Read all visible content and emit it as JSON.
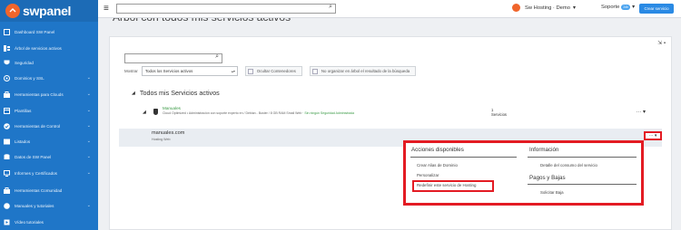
{
  "brand": {
    "name": "swpanel"
  },
  "sidebar": {
    "items": [
      {
        "label": "Dashboard SW Panel",
        "icon": "dashboard-icon",
        "chevron": false
      },
      {
        "label": "Árbol de servicios activos",
        "icon": "tree-icon",
        "chevron": false
      },
      {
        "label": "Seguridad",
        "icon": "shield-icon",
        "chevron": false
      },
      {
        "label": "Dominios y SSL",
        "icon": "domain-icon",
        "chevron": true
      },
      {
        "label": "Herramientas para Clouds",
        "icon": "toolbox-icon",
        "chevron": true
      },
      {
        "label": "Plantillas",
        "icon": "template-icon",
        "chevron": true
      },
      {
        "label": "Herramientas de Control",
        "icon": "check-circle-icon",
        "chevron": true
      },
      {
        "label": "Listados",
        "icon": "list-icon",
        "chevron": true
      },
      {
        "label": "Datos de SW Panel",
        "icon": "database-icon",
        "chevron": true
      },
      {
        "label": "Informes y Certificados",
        "icon": "report-icon",
        "chevron": true
      },
      {
        "label": "Herramientas Comunidad",
        "icon": "community-icon",
        "chevron": false
      },
      {
        "label": "Manuales y tutoriales",
        "icon": "book-icon",
        "chevron": true
      },
      {
        "label": "Vídeo tutoriales",
        "icon": "video-icon",
        "chevron": false
      }
    ]
  },
  "topbar": {
    "search_value": "",
    "user_label": "Sw Hosting · Demo",
    "user_caret": "▾",
    "support_label": "Soporte",
    "support_badge": "24h",
    "create_button": "Crear servicio"
  },
  "page": {
    "title": "Árbol con todos mis servicios activos"
  },
  "filters": {
    "search_value": "",
    "show_label": "Mostrar",
    "select_value": "Todos los Servicios activos",
    "hide_containers": "Ocultar Contenedores",
    "no_tree": "No organizar en árbol el resultado de la búsqueda"
  },
  "tree": {
    "title": "Todos mis Servicios activos",
    "service": {
      "name": "Manuales",
      "description": "Cloud Optimized • Administración con soporte experto en / Debian - Buster / 8 GB RAM Small Web",
      "description_status": "· Sin ningún Seguridad Administrada",
      "count": "1",
      "count_label": "Servicios",
      "dots": "··· ▾"
    },
    "domain": {
      "name": "manuales.com",
      "subtitle": "Hosting Web",
      "dots": "··· ▾"
    }
  },
  "actions_menu": {
    "available_title": "Acciones disponibles",
    "available_items": [
      "Crear Alias de Dominio",
      "Personalizar",
      "Redefinir este servicio de Hosting"
    ],
    "info_title": "Información",
    "info_items": [
      "Detalle del consumo del servicio"
    ],
    "billing_title": "Pagos y Bajas",
    "billing_items": [
      "Solicitar Baja"
    ],
    "highlight_color": "#e31b23"
  },
  "colors": {
    "sidebar": "#1f76c8",
    "accent": "#2a8ae4",
    "highlight": "#e31b23",
    "service_green": "#3a9a45"
  }
}
